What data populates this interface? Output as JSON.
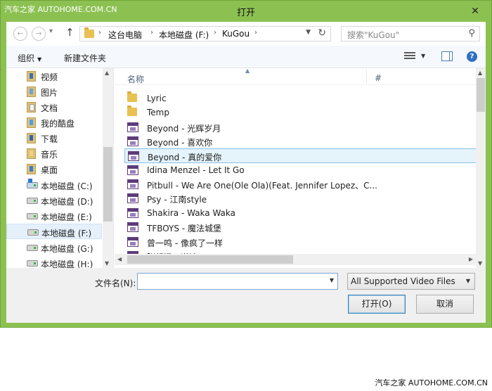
{
  "watermark": {
    "top_left": "汽车之家 AUTOHOME.COM.CN",
    "bottom_right": "汽车之家 AUTOHOME.COM.CN"
  },
  "window": {
    "title": "打开",
    "close_glyph": "✕",
    "accent_color": "#8cc152"
  },
  "nav": {
    "back_glyph": "←",
    "forward_glyph": "→",
    "up_glyph": "↑",
    "breadcrumbs": [
      "这台电脑",
      "本地磁盘 (F:)",
      "KuGou"
    ],
    "refresh_glyph": "↻",
    "search_placeholder": "搜索\"KuGou\"",
    "search_icon": "magnifier-icon"
  },
  "toolbar": {
    "organize_label": "组织",
    "new_folder_label": "新建文件夹",
    "help_label": "?"
  },
  "sidebar": {
    "items": [
      {
        "label": "视频",
        "icon": "videos-library-icon"
      },
      {
        "label": "图片",
        "icon": "pictures-library-icon"
      },
      {
        "label": "文档",
        "icon": "documents-library-icon"
      },
      {
        "label": "我的酷盘",
        "icon": "cloud-drive-icon"
      },
      {
        "label": "下载",
        "icon": "downloads-icon"
      },
      {
        "label": "音乐",
        "icon": "music-library-icon"
      },
      {
        "label": "桌面",
        "icon": "desktop-icon"
      },
      {
        "label": "本地磁盘 (C:)",
        "icon": "system-drive-icon"
      },
      {
        "label": "本地磁盘 (D:)",
        "icon": "drive-icon"
      },
      {
        "label": "本地磁盘 (E:)",
        "icon": "drive-icon"
      },
      {
        "label": "本地磁盘 (F:)",
        "icon": "drive-icon",
        "selected": true
      },
      {
        "label": "本地磁盘 (G:)",
        "icon": "drive-icon"
      },
      {
        "label": "本地磁盘 (H:)",
        "icon": "drive-icon"
      }
    ]
  },
  "filelist": {
    "columns": {
      "name": "名称",
      "number": "#"
    },
    "rows": [
      {
        "name": "Lyric",
        "type": "folder"
      },
      {
        "name": "Temp",
        "type": "folder"
      },
      {
        "name": "Beyond - 光辉岁月",
        "type": "mp3"
      },
      {
        "name": "Beyond - 喜欢你",
        "type": "mp3"
      },
      {
        "name": "Beyond - 真的爱你",
        "type": "mp3",
        "selected": true
      },
      {
        "name": "Idina Menzel - Let It Go",
        "type": "mp3"
      },
      {
        "name": "Pitbull - We Are One(Ole Ola)(Feat. Jennifer Lopez、C...",
        "type": "mp3"
      },
      {
        "name": "Psy - 江南style",
        "type": "mp3"
      },
      {
        "name": "Shakira - Waka Waka",
        "type": "mp3"
      },
      {
        "name": "TFBOYS - 魔法城堡",
        "type": "mp3"
      },
      {
        "name": "曾一鸣 - 像疯了一样",
        "type": "mp3"
      },
      {
        "name": "张韶涵 - 逆流",
        "type": "mp3"
      }
    ]
  },
  "bottom": {
    "filename_label": "文件名(N):",
    "filename_value": "",
    "filetype_value": "All Supported Video Files",
    "open_label": "打开(O)",
    "cancel_label": "取消"
  }
}
